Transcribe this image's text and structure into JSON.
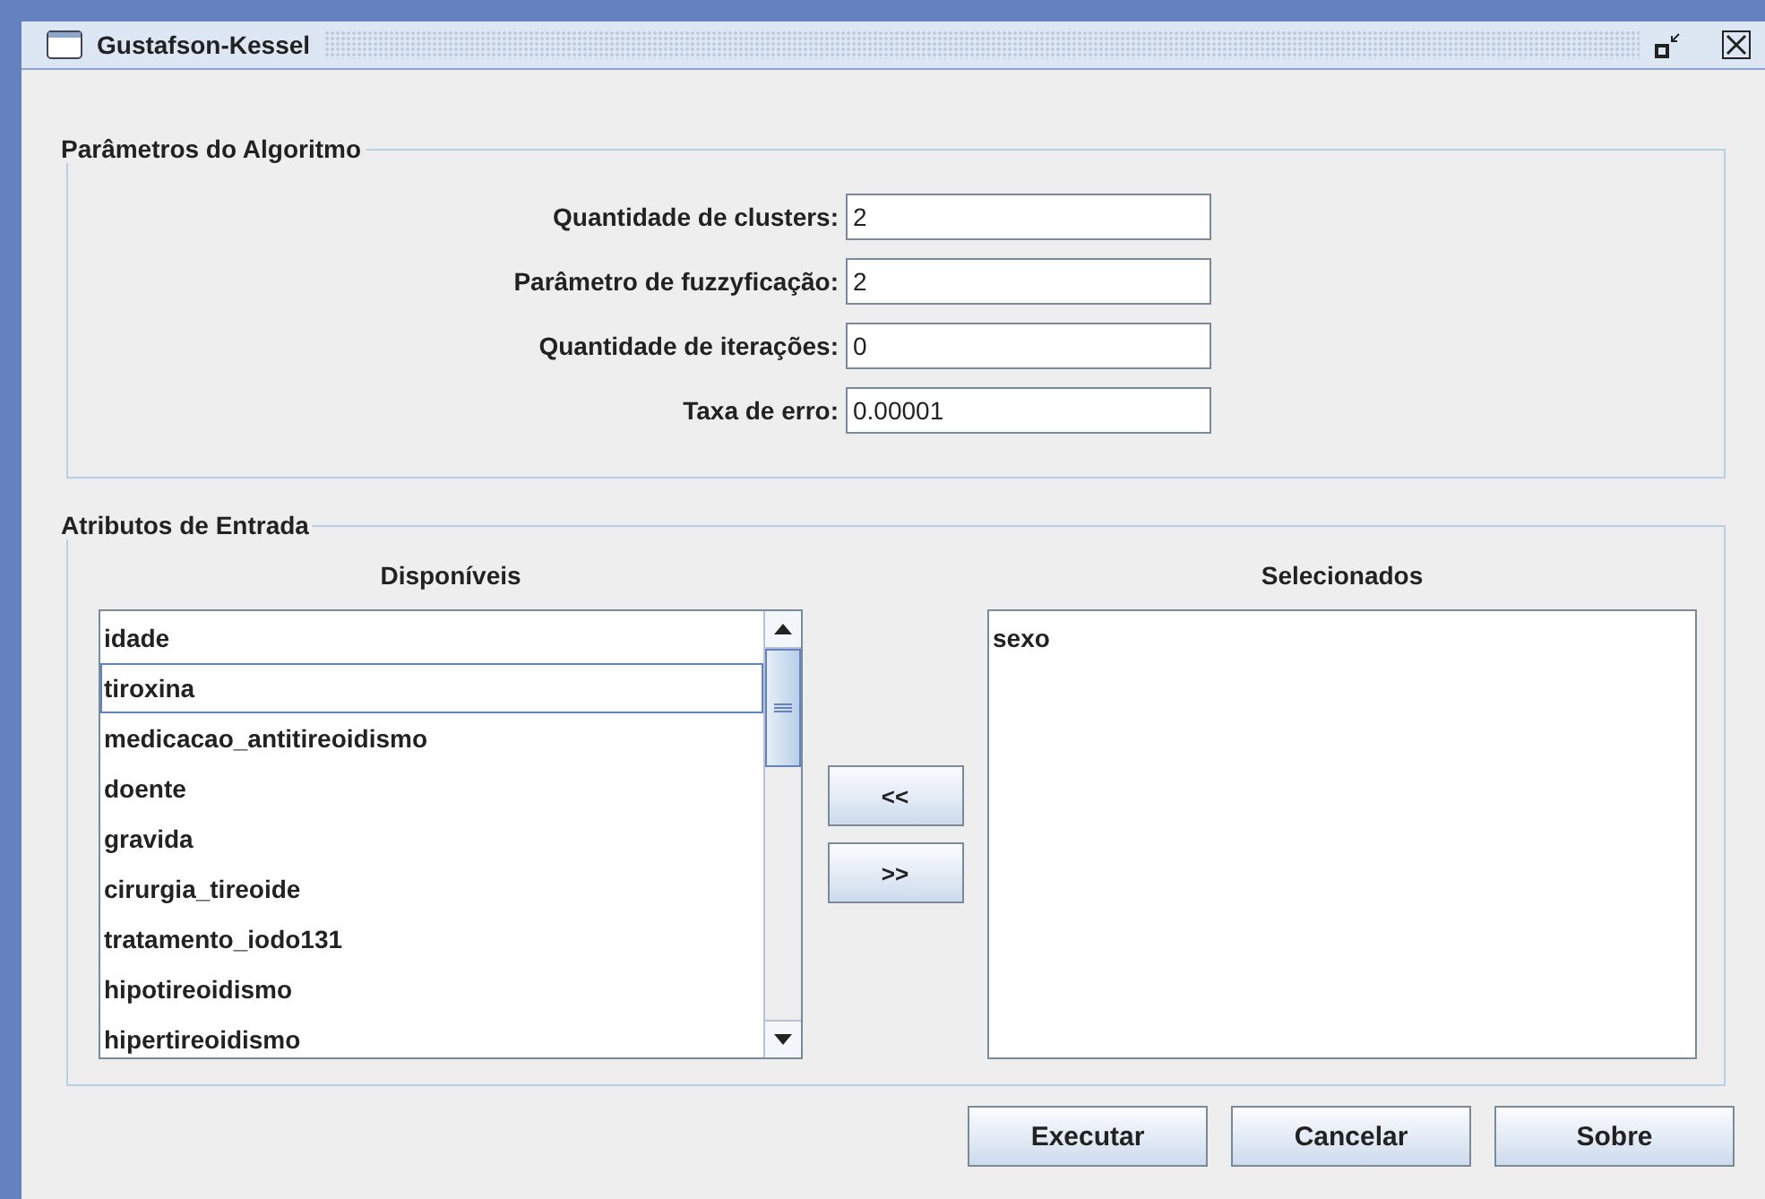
{
  "window": {
    "title": "Gustafson-Kessel"
  },
  "parameters": {
    "legend": "Parâmetros do Algoritmo",
    "fields": [
      {
        "label": "Quantidade de clusters:",
        "value": "2"
      },
      {
        "label": "Parâmetro de fuzzyficação:",
        "value": "2"
      },
      {
        "label": "Quantidade de iterações:",
        "value": "0"
      },
      {
        "label": "Taxa de erro:",
        "value": "0.00001"
      }
    ]
  },
  "attributes": {
    "legend": "Atributos de Entrada",
    "available": {
      "heading": "Disponíveis",
      "items": [
        {
          "label": "idade",
          "focused": false
        },
        {
          "label": "tiroxina",
          "focused": true
        },
        {
          "label": "medicacao_antitireoidismo",
          "focused": false
        },
        {
          "label": "doente",
          "focused": false
        },
        {
          "label": "gravida",
          "focused": false
        },
        {
          "label": "cirurgia_tireoide",
          "focused": false
        },
        {
          "label": "tratamento_iodo131",
          "focused": false
        },
        {
          "label": "hipotireoidismo",
          "focused": false
        },
        {
          "label": "hipertireoidismo",
          "focused": false
        }
      ]
    },
    "move_buttons": [
      "<<",
      ">>"
    ],
    "selected": {
      "heading": "Selecionados",
      "items": [
        {
          "label": "sexo",
          "focused": false
        }
      ]
    }
  },
  "buttons": [
    "Executar",
    "Cancelar",
    "Sobre"
  ]
}
